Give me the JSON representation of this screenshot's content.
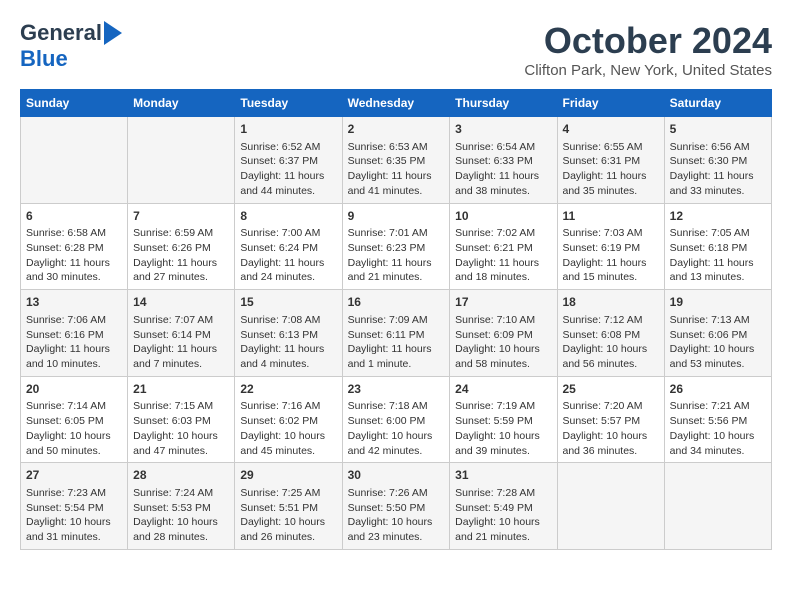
{
  "logo": {
    "line1": "General",
    "line2": "Blue"
  },
  "title": "October 2024",
  "location": "Clifton Park, New York, United States",
  "days_of_week": [
    "Sunday",
    "Monday",
    "Tuesday",
    "Wednesday",
    "Thursday",
    "Friday",
    "Saturday"
  ],
  "weeks": [
    [
      {
        "day": "",
        "info": ""
      },
      {
        "day": "",
        "info": ""
      },
      {
        "day": "1",
        "info": "Sunrise: 6:52 AM\nSunset: 6:37 PM\nDaylight: 11 hours and 44 minutes."
      },
      {
        "day": "2",
        "info": "Sunrise: 6:53 AM\nSunset: 6:35 PM\nDaylight: 11 hours and 41 minutes."
      },
      {
        "day": "3",
        "info": "Sunrise: 6:54 AM\nSunset: 6:33 PM\nDaylight: 11 hours and 38 minutes."
      },
      {
        "day": "4",
        "info": "Sunrise: 6:55 AM\nSunset: 6:31 PM\nDaylight: 11 hours and 35 minutes."
      },
      {
        "day": "5",
        "info": "Sunrise: 6:56 AM\nSunset: 6:30 PM\nDaylight: 11 hours and 33 minutes."
      }
    ],
    [
      {
        "day": "6",
        "info": "Sunrise: 6:58 AM\nSunset: 6:28 PM\nDaylight: 11 hours and 30 minutes."
      },
      {
        "day": "7",
        "info": "Sunrise: 6:59 AM\nSunset: 6:26 PM\nDaylight: 11 hours and 27 minutes."
      },
      {
        "day": "8",
        "info": "Sunrise: 7:00 AM\nSunset: 6:24 PM\nDaylight: 11 hours and 24 minutes."
      },
      {
        "day": "9",
        "info": "Sunrise: 7:01 AM\nSunset: 6:23 PM\nDaylight: 11 hours and 21 minutes."
      },
      {
        "day": "10",
        "info": "Sunrise: 7:02 AM\nSunset: 6:21 PM\nDaylight: 11 hours and 18 minutes."
      },
      {
        "day": "11",
        "info": "Sunrise: 7:03 AM\nSunset: 6:19 PM\nDaylight: 11 hours and 15 minutes."
      },
      {
        "day": "12",
        "info": "Sunrise: 7:05 AM\nSunset: 6:18 PM\nDaylight: 11 hours and 13 minutes."
      }
    ],
    [
      {
        "day": "13",
        "info": "Sunrise: 7:06 AM\nSunset: 6:16 PM\nDaylight: 11 hours and 10 minutes."
      },
      {
        "day": "14",
        "info": "Sunrise: 7:07 AM\nSunset: 6:14 PM\nDaylight: 11 hours and 7 minutes."
      },
      {
        "day": "15",
        "info": "Sunrise: 7:08 AM\nSunset: 6:13 PM\nDaylight: 11 hours and 4 minutes."
      },
      {
        "day": "16",
        "info": "Sunrise: 7:09 AM\nSunset: 6:11 PM\nDaylight: 11 hours and 1 minute."
      },
      {
        "day": "17",
        "info": "Sunrise: 7:10 AM\nSunset: 6:09 PM\nDaylight: 10 hours and 58 minutes."
      },
      {
        "day": "18",
        "info": "Sunrise: 7:12 AM\nSunset: 6:08 PM\nDaylight: 10 hours and 56 minutes."
      },
      {
        "day": "19",
        "info": "Sunrise: 7:13 AM\nSunset: 6:06 PM\nDaylight: 10 hours and 53 minutes."
      }
    ],
    [
      {
        "day": "20",
        "info": "Sunrise: 7:14 AM\nSunset: 6:05 PM\nDaylight: 10 hours and 50 minutes."
      },
      {
        "day": "21",
        "info": "Sunrise: 7:15 AM\nSunset: 6:03 PM\nDaylight: 10 hours and 47 minutes."
      },
      {
        "day": "22",
        "info": "Sunrise: 7:16 AM\nSunset: 6:02 PM\nDaylight: 10 hours and 45 minutes."
      },
      {
        "day": "23",
        "info": "Sunrise: 7:18 AM\nSunset: 6:00 PM\nDaylight: 10 hours and 42 minutes."
      },
      {
        "day": "24",
        "info": "Sunrise: 7:19 AM\nSunset: 5:59 PM\nDaylight: 10 hours and 39 minutes."
      },
      {
        "day": "25",
        "info": "Sunrise: 7:20 AM\nSunset: 5:57 PM\nDaylight: 10 hours and 36 minutes."
      },
      {
        "day": "26",
        "info": "Sunrise: 7:21 AM\nSunset: 5:56 PM\nDaylight: 10 hours and 34 minutes."
      }
    ],
    [
      {
        "day": "27",
        "info": "Sunrise: 7:23 AM\nSunset: 5:54 PM\nDaylight: 10 hours and 31 minutes."
      },
      {
        "day": "28",
        "info": "Sunrise: 7:24 AM\nSunset: 5:53 PM\nDaylight: 10 hours and 28 minutes."
      },
      {
        "day": "29",
        "info": "Sunrise: 7:25 AM\nSunset: 5:51 PM\nDaylight: 10 hours and 26 minutes."
      },
      {
        "day": "30",
        "info": "Sunrise: 7:26 AM\nSunset: 5:50 PM\nDaylight: 10 hours and 23 minutes."
      },
      {
        "day": "31",
        "info": "Sunrise: 7:28 AM\nSunset: 5:49 PM\nDaylight: 10 hours and 21 minutes."
      },
      {
        "day": "",
        "info": ""
      },
      {
        "day": "",
        "info": ""
      }
    ]
  ]
}
